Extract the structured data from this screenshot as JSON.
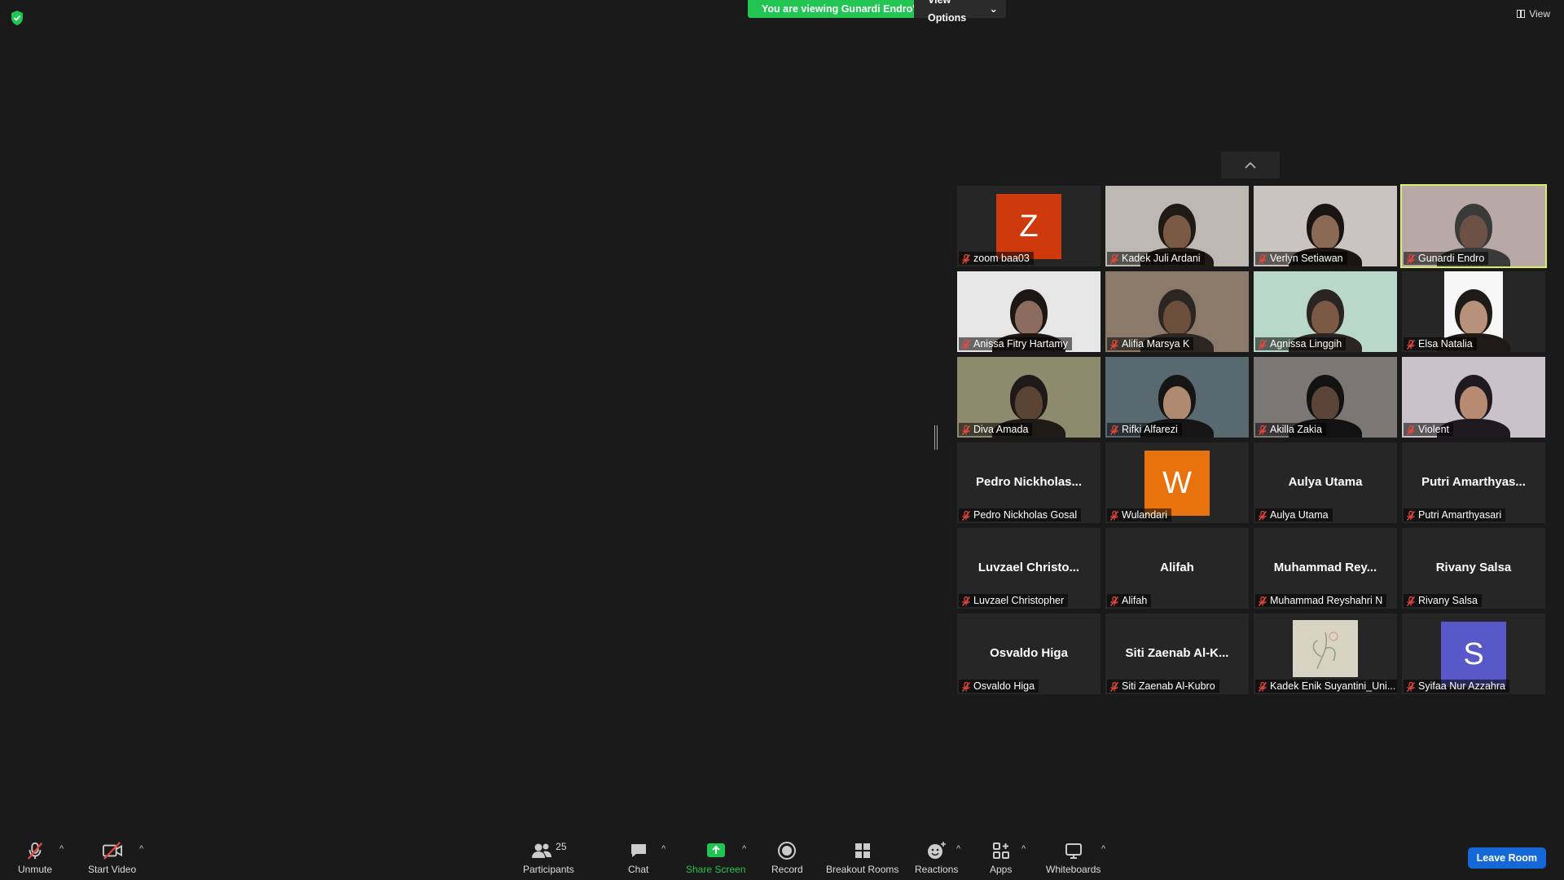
{
  "banner": {
    "text": "You are viewing Gunardi Endro's screen",
    "options_label": "View Options"
  },
  "view_label": "View",
  "tiles": [
    {
      "label": "zoom baa03",
      "type": "avatar",
      "initial": "Z",
      "color": "#cf3a0c"
    },
    {
      "label": "Kadek Juli Ardani",
      "type": "video",
      "bg": "#bdb8b2",
      "skin": "#7a5a45",
      "hair": "#201a16"
    },
    {
      "label": "Verlyn Setiawan",
      "type": "video",
      "bg": "#c9c4bf",
      "skin": "#8a6a55",
      "hair": "#1a1512"
    },
    {
      "label": "Gunardi Endro",
      "type": "video",
      "bg": "#b9a9a6",
      "skin": "#6c5246",
      "hair": "#3a3a3a",
      "active": true
    },
    {
      "label": "Anissa Fitry Hartamy",
      "type": "video",
      "bg": "#e6e6e6",
      "skin": "#8c6d5d",
      "hair": "#1c1714"
    },
    {
      "label": "Alifia Marsya K",
      "type": "video",
      "bg": "#8b7a6a",
      "skin": "#6c4e3c",
      "hair": "#2b2622"
    },
    {
      "label": "Agnissa Linggih",
      "type": "video",
      "bg": "#b9d8c9",
      "skin": "#7a5a44",
      "hair": "#2a2422"
    },
    {
      "label": "Elsa Natalia",
      "type": "video",
      "bg": "#f7f7f7",
      "skin": "#b8917a",
      "hair": "#1d1a18",
      "narrow": true
    },
    {
      "label": "Diva Amada",
      "type": "video",
      "bg": "#8e8a6e",
      "skin": "#5a4534",
      "hair": "#1e1a18"
    },
    {
      "label": "Rifki Alfarezi",
      "type": "video",
      "bg": "#586a70",
      "skin": "#b08a70",
      "hair": "#151515"
    },
    {
      "label": "Akilla Zakia",
      "type": "video",
      "bg": "#7b7775",
      "skin": "#5b4538",
      "hair": "#121212"
    },
    {
      "label": "Violent",
      "type": "video",
      "bg": "#c9c2c8",
      "skin": "#b88a72",
      "hair": "#1e1a20"
    },
    {
      "label": "Pedro Nickholas Gosal",
      "type": "name",
      "bigname": "Pedro  Nickholas..."
    },
    {
      "label": "Wulandari",
      "type": "avatar",
      "initial": "W",
      "color": "#e8720c"
    },
    {
      "label": "Aulya Utama",
      "type": "name",
      "bigname": "Aulya Utama"
    },
    {
      "label": "Putri Amarthyasari",
      "type": "name",
      "bigname": "Putri  Amarthyas..."
    },
    {
      "label": "Luvzael Christopher",
      "type": "name",
      "bigname": "Luvzael  Christo..."
    },
    {
      "label": "Alifah",
      "type": "name",
      "bigname": "Alifah"
    },
    {
      "label": "Muhammad Reyshahri N",
      "type": "name",
      "bigname": "Muhammad  Rey..."
    },
    {
      "label": "Rivany Salsa",
      "type": "name",
      "bigname": "Rivany Salsa"
    },
    {
      "label": "Osvaldo Higa",
      "type": "name",
      "bigname": "Osvaldo Higa"
    },
    {
      "label": "Siti Zaenab Al-Kubro",
      "type": "name",
      "bigname": "Siti  Zaenab  Al-K..."
    },
    {
      "label": "Kadek Enik Suyantini_Uni...",
      "type": "image",
      "color": "#d9d3c4"
    },
    {
      "label": "Syifaa Nur Azzahra",
      "type": "avatar",
      "initial": "S",
      "color": "#5858c8"
    }
  ],
  "toolbar": {
    "unmute": "Unmute",
    "start_video": "Start Video",
    "participants": "Participants",
    "participants_count": "25",
    "chat": "Chat",
    "share_screen": "Share Screen",
    "record": "Record",
    "breakout_rooms": "Breakout Rooms",
    "reactions": "Reactions",
    "apps": "Apps",
    "whiteboards": "Whiteboards",
    "leave": "Leave Room"
  },
  "colors": {
    "share_green": "#23c552",
    "leave_blue": "#1568d8",
    "active_border": "#d8ef6b",
    "mic_red": "#e8463e"
  }
}
